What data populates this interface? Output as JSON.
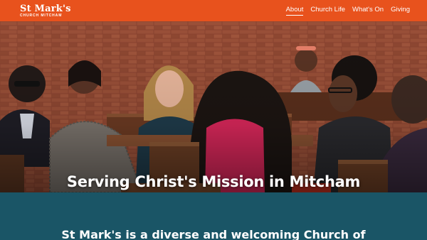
{
  "header": {
    "logo_title": "St Mark's",
    "logo_subtitle": "CHURCH MITCHAM",
    "nav": [
      {
        "label": "About",
        "active": true
      },
      {
        "label": "Church Life",
        "active": false
      },
      {
        "label": "What's On",
        "active": false
      },
      {
        "label": "Giving",
        "active": false
      }
    ],
    "brand_color": "#e8521d"
  },
  "hero": {
    "title": "Serving Christ's Mission in Mitcham",
    "image": "congregation-in-pews-photo"
  },
  "intro": {
    "text": "St Mark's is a diverse and welcoming Church of",
    "background_color": "#1a5566"
  }
}
